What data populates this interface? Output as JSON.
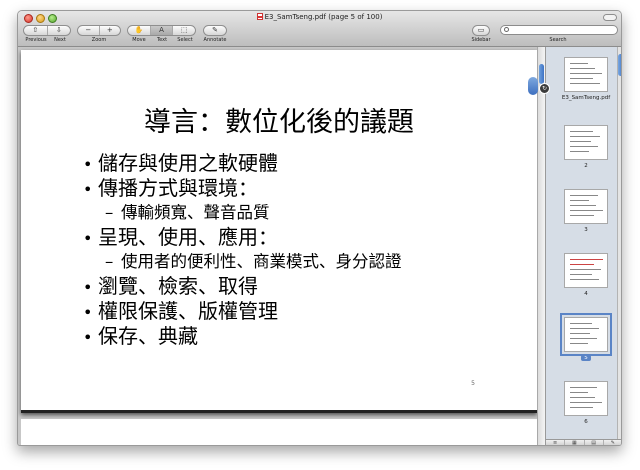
{
  "window": {
    "title": "E3_SamTseng.pdf (page 5 of 100)"
  },
  "toolbar": {
    "previous_label": "Previous",
    "next_label": "Next",
    "zoom_label": "Zoom",
    "move_label": "Move",
    "text_label": "Text",
    "select_label": "Select",
    "annotate_label": "Annotate",
    "sidebar_label": "Sidebar",
    "search_label": "Search",
    "search_placeholder": ""
  },
  "page": {
    "heading": "導言：數位化後的議題",
    "page_number": "5",
    "bullets": [
      {
        "level": 1,
        "text": "儲存與使用之軟硬體"
      },
      {
        "level": 1,
        "text": "傳播方式與環境："
      },
      {
        "level": 2,
        "text": "傳輸頻寬、聲音品質"
      },
      {
        "level": 1,
        "text": "呈現、使用、應用："
      },
      {
        "level": 2,
        "text": "使用者的便利性、商業模式、身分認證"
      },
      {
        "level": 1,
        "text": "瀏覽、檢索、取得"
      },
      {
        "level": 1,
        "text": "權限保護、版權管理"
      },
      {
        "level": 1,
        "text": "保存、典藏"
      }
    ]
  },
  "sidebar": {
    "thumbnails": [
      {
        "label": "E3_SamTseng.pdf",
        "selected": false
      },
      {
        "label": "2",
        "selected": false
      },
      {
        "label": "3",
        "selected": false
      },
      {
        "label": "4",
        "selected": false
      },
      {
        "label": "5",
        "selected": true
      },
      {
        "label": "6",
        "selected": false
      }
    ]
  },
  "colors": {
    "selection": "#5a84c6",
    "title_bar": "#bdbdbd"
  }
}
